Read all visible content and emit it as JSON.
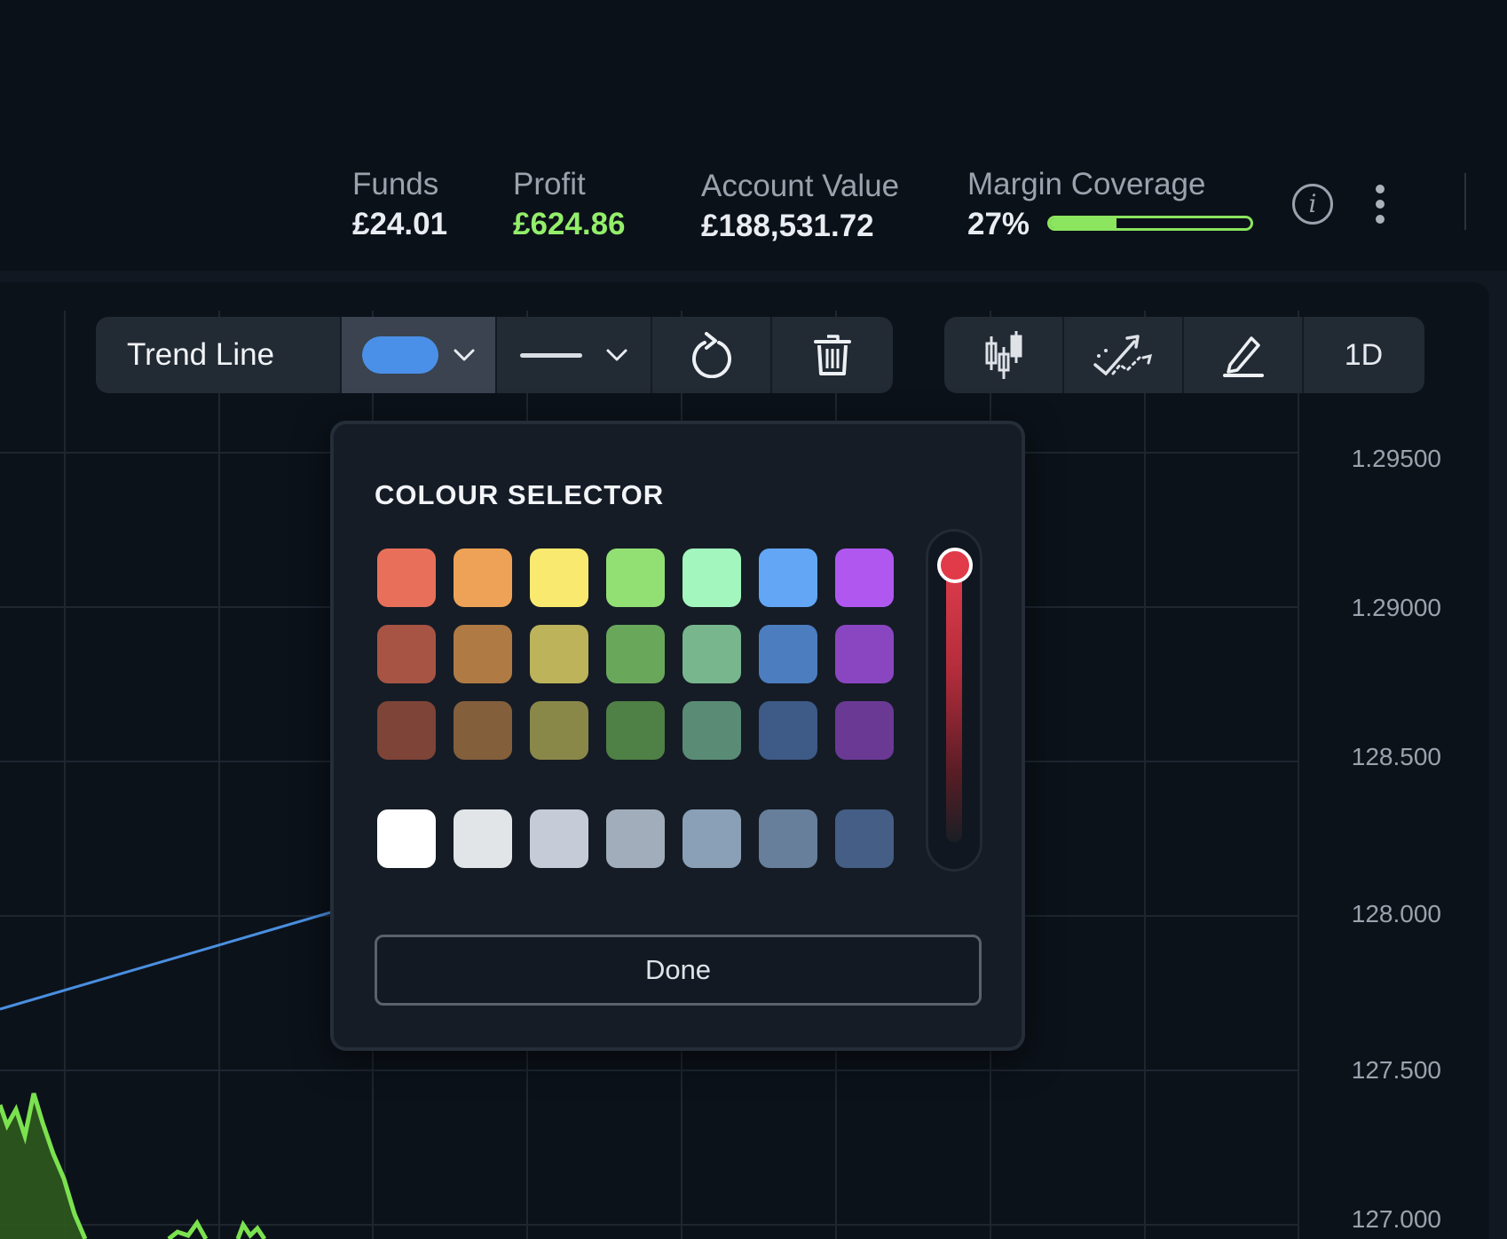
{
  "header": {
    "stats": [
      {
        "label": "Funds",
        "value": "£24.01"
      },
      {
        "label": "Profit",
        "value": "£624.86"
      },
      {
        "label": "Account Value",
        "value": "£188,531.72"
      }
    ],
    "margin": {
      "label": "Margin Coverage",
      "value": "27%",
      "fill_fraction": 0.33,
      "color": "#8be55e"
    },
    "info_icon": "info-icon",
    "info_glyph": "i",
    "more_icon": "more-vertical-icon"
  },
  "drawing_toolbar": {
    "tool_label": "Trend Line",
    "selected_color": "#4a90e8",
    "line_style": "solid",
    "icons": [
      "chevron-down-icon",
      "reset-icon",
      "trash-icon"
    ]
  },
  "chart_toolbar": {
    "icons": [
      "candlestick-icon",
      "indicator-icon",
      "draw-icon"
    ],
    "interval": "1D"
  },
  "price_axis": {
    "labels": [
      "1.29500",
      "1.29000",
      "128.500",
      "128.000",
      "127.500",
      "127.000"
    ]
  },
  "colour_selector": {
    "title": "COLOUR SELECTOR",
    "rows": [
      [
        "#e8705a",
        "#eea257",
        "#f9ea6f",
        "#92df74",
        "#a2f6be",
        "#63a6f5",
        "#b057f0"
      ],
      [
        "#a75444",
        "#b07a45",
        "#bcb35a",
        "#69a85b",
        "#78b68d",
        "#4c7dbf",
        "#8a46c1"
      ],
      [
        "#7d4437",
        "#835f3c",
        "#8a8849",
        "#4f8045",
        "#5a8b75",
        "#3e5a86",
        "#6a3994"
      ],
      [
        "#ffffff",
        "#e1e5e8",
        "#c5cbd7",
        "#a1adbb",
        "#8aa0b7",
        "#677f9a",
        "#445e85"
      ]
    ],
    "slider": {
      "value": 1.0,
      "color": "#e13a48"
    },
    "done_label": "Done"
  }
}
